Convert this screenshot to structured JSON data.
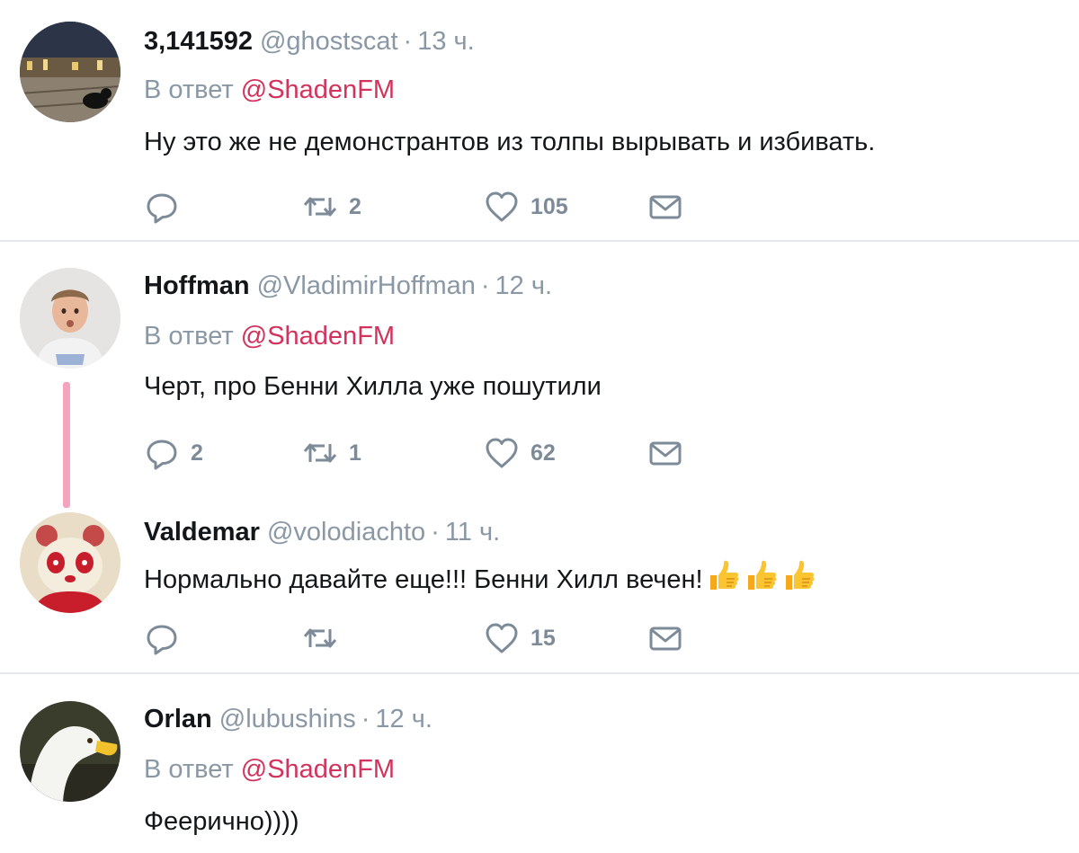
{
  "tweets": [
    {
      "name": "3,141592",
      "handle": "@ghostscat",
      "time": "13 ч.",
      "reply_prefix": "В ответ",
      "reply_to": "@ShadenFM",
      "text": "Ну это же не демонстрантов из толпы вырывать и избивать.",
      "replies": "",
      "retweets": "2",
      "likes": "105"
    },
    {
      "name": "Hoffman",
      "handle": "@VladimirHoffman",
      "time": "12 ч.",
      "reply_prefix": "В ответ",
      "reply_to": "@ShadenFM",
      "text": "Черт, про Бенни Хилла уже пошутили",
      "replies": "2",
      "retweets": "1",
      "likes": "62"
    },
    {
      "name": "Valdemar",
      "handle": "@volodiachto",
      "time": "11 ч.",
      "text": "Нормально давайте еще!!! Бенни Хилл вечен!",
      "emoji": [
        "thumbs-up-icon",
        "thumbs-up-icon",
        "thumbs-up-icon"
      ],
      "replies": "",
      "retweets": "",
      "likes": "15"
    },
    {
      "name": "Orlan",
      "handle": "@lubushins",
      "time": "12 ч.",
      "reply_prefix": "В ответ",
      "reply_to": "@ShadenFM",
      "text": "Феерично))))"
    }
  ],
  "colors": {
    "mention": "#d2335c",
    "muted": "#8a98a5",
    "icon": "#7d8b98",
    "thread_line": "#f4a4bd",
    "divider": "#e4e8ec"
  },
  "dot": "·"
}
